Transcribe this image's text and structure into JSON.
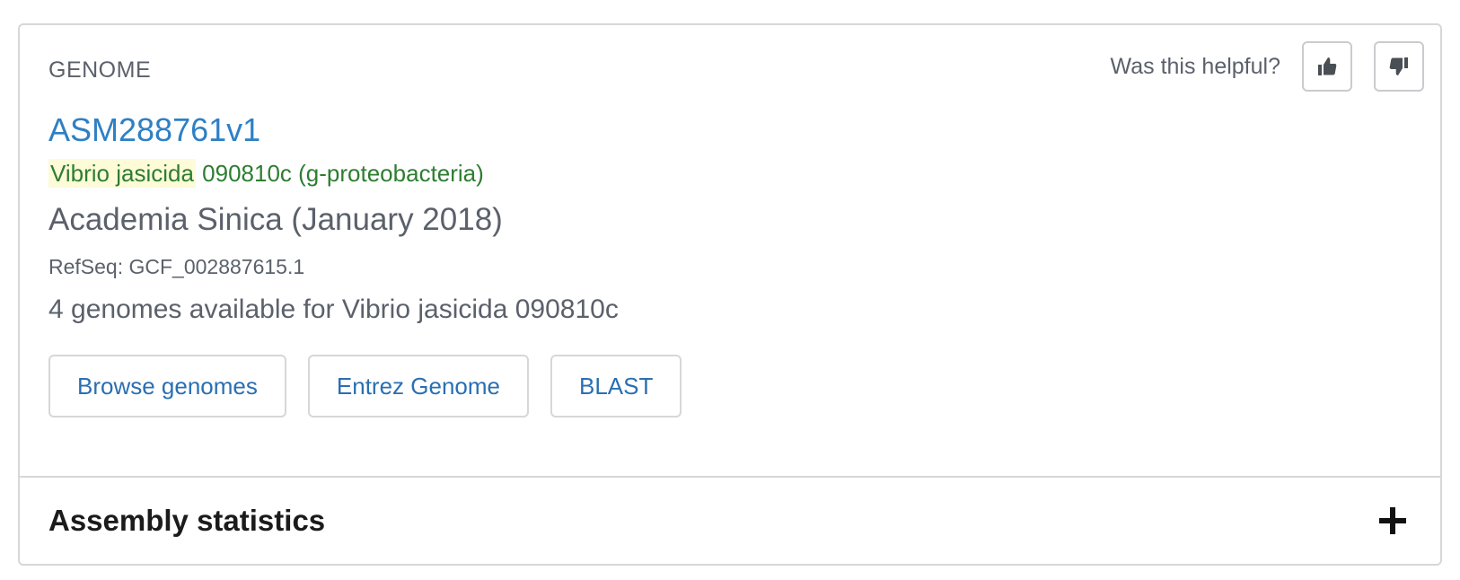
{
  "card": {
    "section_label": "GENOME",
    "helpful": {
      "question": "Was this helpful?",
      "thumbs_up_icon": "thumbs-up-icon",
      "thumbs_down_icon": "thumbs-down-icon"
    },
    "assembly_name": "ASM288761v1",
    "organism": {
      "highlight": "Vibrio jasicida",
      "rest": " 090810c (g-proteobacteria)"
    },
    "submitter": "Academia Sinica (January 2018)",
    "refseq": "RefSeq: GCF_002887615.1",
    "available": "4 genomes available for Vibrio jasicida 090810c",
    "buttons": {
      "browse": "Browse genomes",
      "entrez": "Entrez Genome",
      "blast": "BLAST"
    },
    "stats": {
      "title": "Assembly statistics",
      "expand_icon": "plus-icon"
    }
  },
  "colors": {
    "link": "#2e80c4",
    "organism": "#2e7d32",
    "highlight": "#fdfbd8",
    "border": "#d6d7d9"
  }
}
